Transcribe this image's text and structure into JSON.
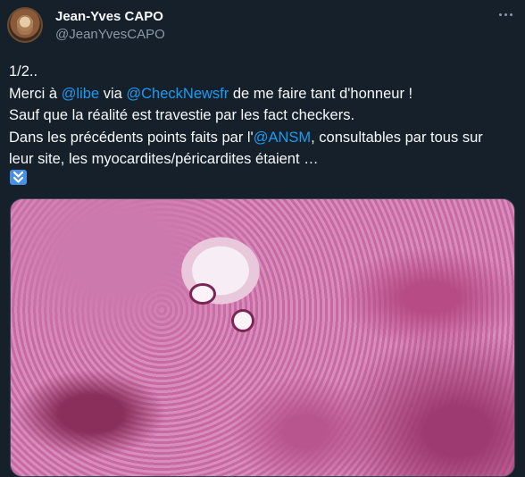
{
  "tweet": {
    "author_name": "Jean-Yves CAPO",
    "author_handle": "@JeanYvesCAPO",
    "lines": {
      "l1": "1/2..",
      "l2a": "Merci à ",
      "l2_mention1": "@libe",
      "l2b": " via ",
      "l2_mention2": "@CheckNewsfr",
      "l2c": " de me faire tant d'honneur !",
      "l3": "Sauf que la réalité est travestie par les fact checkers.",
      "l4a": "Dans les précédents points faits par l'",
      "l4_mention": "@ANSM",
      "l4b": ", consultables par tous sur",
      "l5": "leur site, les myocardites/péricardites étaient …"
    },
    "emoji": "⏬",
    "colors": {
      "background": "#15202b",
      "text": "#f7f9f9",
      "secondary_text": "#8b98a5",
      "mention": "#1d9bf0"
    }
  },
  "icons": {
    "more": "more-horizontal-icon",
    "emoji": "double-down-arrow-icon"
  }
}
